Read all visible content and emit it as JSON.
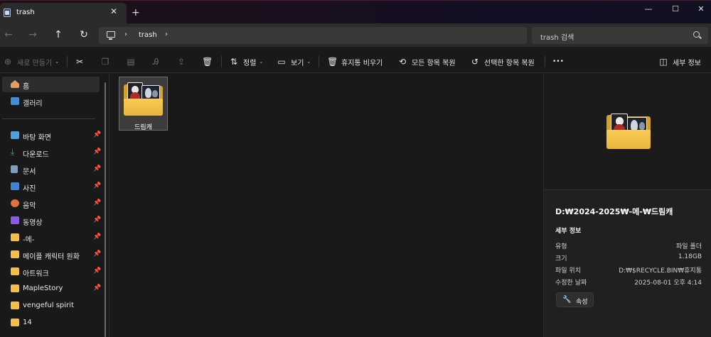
{
  "window": {
    "tab_title": "trash",
    "tab_close": "✕",
    "new_tab": "+",
    "minimize": "—",
    "maximize": "☐",
    "close": "✕"
  },
  "address": {
    "back": "←",
    "forward": "→",
    "up": "↑",
    "refresh": "↻",
    "path_chevron": "›",
    "crumb": "trash",
    "crumb_chevron": "›",
    "search_placeholder": "trash 검색"
  },
  "toolbar": {
    "new_label": "새로 만들기",
    "sort_label": "정렬",
    "view_label": "보기",
    "empty_bin_label": "휴지통 비우기",
    "restore_all_label": "모든 항목 복원",
    "restore_selected_label": "선택한 항목 복원",
    "more_label": "•••",
    "details_label": "세부 정보"
  },
  "sidebar": {
    "items": [
      {
        "label": "홈",
        "icon": "home-icon",
        "color": "#e0a060"
      },
      {
        "label": "갤러리",
        "icon": "gallery-icon",
        "color": "#3e8fd8"
      },
      {
        "label": "바탕 화면",
        "icon": "desktop-icon",
        "color": "#4aa3e0",
        "pinned": true
      },
      {
        "label": "다운로드",
        "icon": "download-icon",
        "color": "#2fb58a",
        "pinned": true
      },
      {
        "label": "문서",
        "icon": "documents-icon",
        "color": "#7f9dbd",
        "pinned": true
      },
      {
        "label": "사진",
        "icon": "pictures-icon",
        "color": "#3f86d0",
        "pinned": true
      },
      {
        "label": "음악",
        "icon": "music-icon",
        "color": "#e0703c",
        "pinned": true
      },
      {
        "label": "동영상",
        "icon": "videos-icon",
        "color": "#8a5ce0",
        "pinned": true
      },
      {
        "label": "-메-",
        "icon": "folder-icon",
        "color": "#f2c04a",
        "pinned": true
      },
      {
        "label": "메이플 캐릭터 원화",
        "icon": "folder-icon",
        "color": "#f2c04a",
        "pinned": true
      },
      {
        "label": "아트워크",
        "icon": "folder-icon",
        "color": "#f2c04a",
        "pinned": true
      },
      {
        "label": "MapleStory",
        "icon": "folder-icon",
        "color": "#f2c04a",
        "pinned": true
      },
      {
        "label": "vengeful spirit",
        "icon": "folder-icon",
        "color": "#f2c04a"
      },
      {
        "label": "14",
        "icon": "folder-icon",
        "color": "#f2c04a"
      }
    ],
    "pin_glyph": "📌"
  },
  "content": {
    "items": [
      {
        "name": "드림캐"
      }
    ]
  },
  "details": {
    "path": "D:₩2024-2025₩-메-₩드림캐",
    "section_title": "세부 정보",
    "rows": [
      {
        "key": "유형",
        "value": "파일 폴더"
      },
      {
        "key": "크기",
        "value": "1.18GB"
      },
      {
        "key": "파일 위치",
        "value": "D:₩$RECYCLE.BIN₩휴지통"
      },
      {
        "key": "수정한 날짜",
        "value": "2025-08-01 오후 4:14"
      }
    ],
    "properties_label": "속성"
  }
}
